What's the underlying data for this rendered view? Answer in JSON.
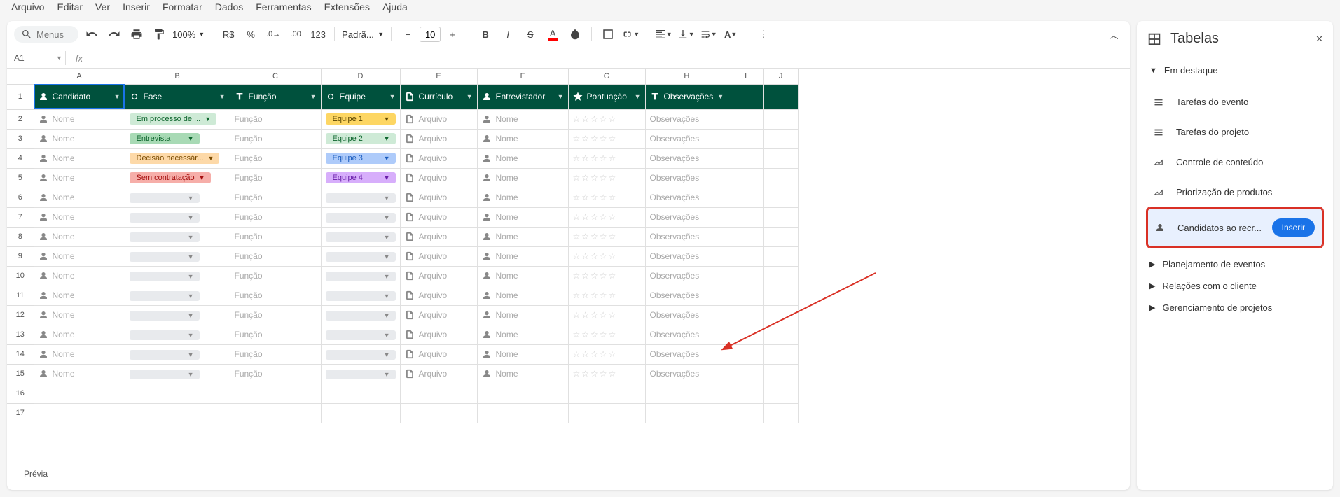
{
  "menubar": [
    "Arquivo",
    "Editar",
    "Ver",
    "Inserir",
    "Formatar",
    "Dados",
    "Ferramentas",
    "Extensões",
    "Ajuda"
  ],
  "toolbar": {
    "search_placeholder": "Menus",
    "zoom": "100%",
    "currency": "R$",
    "percent": "%",
    "numfmt": "123",
    "font": "Padrã...",
    "size": "10"
  },
  "namebox": "A1",
  "columns_letters": [
    "A",
    "B",
    "C",
    "D",
    "E",
    "F",
    "G",
    "H",
    "I",
    "J"
  ],
  "headers": [
    {
      "label": "Candidato",
      "icon": "person"
    },
    {
      "label": "Fase",
      "icon": "tag"
    },
    {
      "label": "Função",
      "icon": "text"
    },
    {
      "label": "Equipe",
      "icon": "tag"
    },
    {
      "label": "Currículo",
      "icon": "file"
    },
    {
      "label": "Entrevistador",
      "icon": "person"
    },
    {
      "label": "Pontuação",
      "icon": "star"
    },
    {
      "label": "Observações",
      "icon": "text"
    }
  ],
  "phase_chips": [
    {
      "label": "Em processo de ...",
      "bg": "#ceead6",
      "fg": "#0d652d"
    },
    {
      "label": "Entrevista",
      "bg": "#a8dab5",
      "fg": "#0d652d"
    },
    {
      "label": "Decisão necessár...",
      "bg": "#fdd9a8",
      "fg": "#7a4b00"
    },
    {
      "label": "Sem contratação",
      "bg": "#f6aea9",
      "fg": "#a50e0e"
    }
  ],
  "team_chips": [
    {
      "label": "Equipe 1",
      "bg": "#fdd663",
      "fg": "#594400"
    },
    {
      "label": "Equipe 2",
      "bg": "#ceead6",
      "fg": "#0d652d"
    },
    {
      "label": "Equipe 3",
      "bg": "#aecbfa",
      "fg": "#185abc"
    },
    {
      "label": "Equipe 4",
      "bg": "#d7aefb",
      "fg": "#681da8"
    }
  ],
  "cell_placeholders": {
    "nome": "Nome",
    "funcao": "Função",
    "arquivo": "Arquivo",
    "obs": "Observações"
  },
  "row_count": 14,
  "extra_rows": [
    16,
    17
  ],
  "previa": "Prévia",
  "panel": {
    "title": "Tabelas",
    "featured": "Em destaque",
    "featured_items": [
      {
        "label": "Tarefas do evento",
        "icon": "checklist"
      },
      {
        "label": "Tarefas do projeto",
        "icon": "checklist"
      },
      {
        "label": "Controle de conteúdo",
        "icon": "chart"
      },
      {
        "label": "Priorização de produtos",
        "icon": "chart"
      },
      {
        "label": "Candidatos ao recr...",
        "icon": "person",
        "highlight": true,
        "insert": "Inserir"
      }
    ],
    "categories": [
      "Planejamento de eventos",
      "Relações com o cliente",
      "Gerenciamento de projetos"
    ]
  },
  "col_widths": {
    "A": 130,
    "B": 150,
    "C": 130,
    "D": 110,
    "E": 110,
    "F": 130,
    "G": 110,
    "H": 110,
    "I": 50,
    "J": 50
  }
}
